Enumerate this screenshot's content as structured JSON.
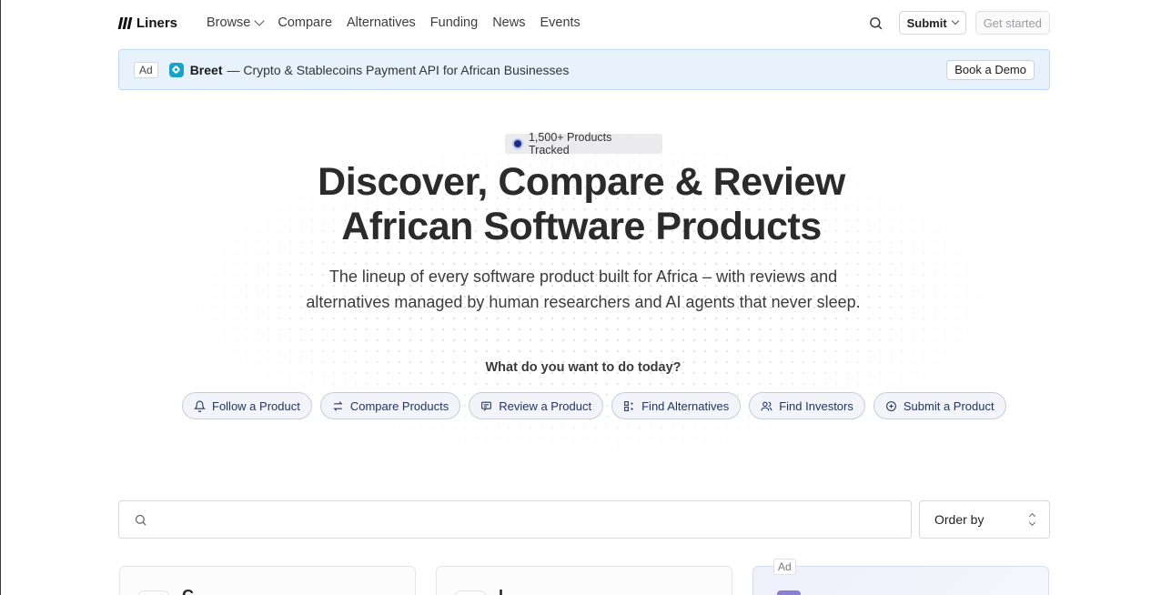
{
  "brand": {
    "name": "Liners"
  },
  "nav": {
    "links": [
      "Browse",
      "Compare",
      "Alternatives",
      "Funding",
      "News",
      "Events"
    ],
    "submit_label": "Submit",
    "get_started_label": "Get started"
  },
  "ad_banner": {
    "tag": "Ad",
    "brand": "Breet",
    "text": "— Crypto & Stablecoins Payment API for African Businesses",
    "cta": "Book a Demo"
  },
  "hero": {
    "badge": "1,500+ Products Tracked",
    "title_line1": "Discover, Compare & Review",
    "title_line2": "African Software Products",
    "subtitle_line1": "The lineup of every software product built for Africa – with reviews and",
    "subtitle_line2": "alternatives managed by human researchers and AI agents that never sleep.",
    "question": "What do you want to do today?",
    "actions": [
      {
        "label": "Follow a Product",
        "icon": "bell-icon"
      },
      {
        "label": "Compare Products",
        "icon": "swap-icon"
      },
      {
        "label": "Review a Product",
        "icon": "message-icon"
      },
      {
        "label": "Find Alternatives",
        "icon": "grid-search-icon"
      },
      {
        "label": "Find Investors",
        "icon": "users-icon"
      },
      {
        "label": "Submit a Product",
        "icon": "plus-circle-icon"
      }
    ]
  },
  "search": {
    "placeholder": ""
  },
  "order_by": {
    "label": "Order by"
  },
  "cards": [
    {
      "name": "C..."
    },
    {
      "name": "I..."
    }
  ],
  "ad_card": {
    "tag": "Ad"
  },
  "colors": {
    "ad_banner_bg": "#e8f2fd",
    "chip_bg": "#f2f4f9",
    "chip_text": "#26355e",
    "badge_dot": "#1e2c82"
  }
}
